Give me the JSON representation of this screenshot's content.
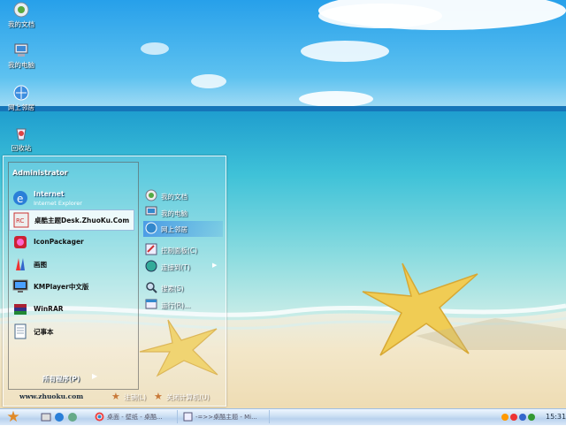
{
  "desktop": {
    "icons": [
      {
        "label": "我的文档"
      },
      {
        "label": "我的电脑"
      },
      {
        "label": "网上邻居"
      },
      {
        "label": "回收站"
      }
    ]
  },
  "start_menu": {
    "user": "Administrator",
    "programs": [
      {
        "name": "Internet",
        "sub": "Internet Explorer"
      },
      {
        "name": "桌酷主题Desk.ZhuoKu.Com"
      },
      {
        "name": "IconPackager"
      },
      {
        "name": "画图"
      },
      {
        "name": "KMPlayer中文版"
      },
      {
        "name": "WinRAR"
      },
      {
        "name": "记事本"
      }
    ],
    "places": [
      {
        "label": "我的文档"
      },
      {
        "label": "我的电脑"
      },
      {
        "label": "网上邻居"
      },
      {
        "label": "控制面板(C)"
      },
      {
        "label": "连接到(T)"
      },
      {
        "label": "搜索(S)"
      },
      {
        "label": "运行(R)..."
      }
    ],
    "all_programs": "所有程序(P)",
    "website": "www.zhuoku.com",
    "logoff": "注销(L)",
    "shutdown": "关闭计算机(U)"
  },
  "taskbar": {
    "tasks": [
      {
        "label": "桌面 - 壁纸 - 桌酷..."
      },
      {
        "label": "-=>>桌酷主题 - Mi..."
      }
    ],
    "clock": "15:31"
  },
  "colors": {
    "sky_top": "#3aa7e8",
    "sea": "#2fb8d6",
    "sand": "#f2e6c8",
    "taskbar": "#cfe1f4"
  }
}
